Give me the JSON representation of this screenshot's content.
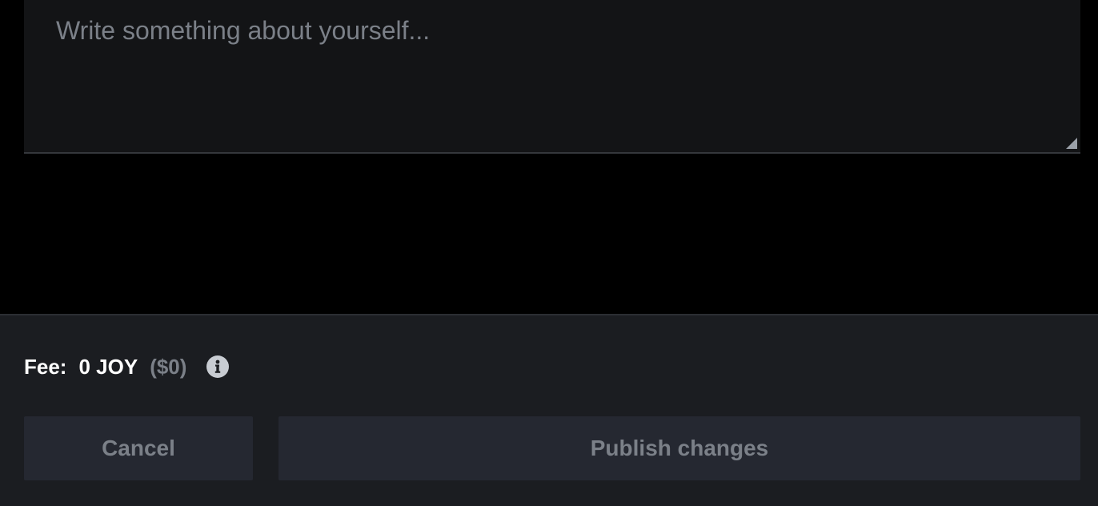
{
  "bio": {
    "placeholder": "Write something about yourself...",
    "value": ""
  },
  "fee": {
    "label": "Fee:",
    "amount": "0 JOY",
    "usd": "($0)",
    "info_icon": "info-icon"
  },
  "actions": {
    "cancel_label": "Cancel",
    "publish_label": "Publish changes"
  },
  "colors": {
    "background": "#000000",
    "textarea_bg": "#131416",
    "footer_bg": "#1b1d21",
    "button_bg": "#252831",
    "muted_text": "#7b8088",
    "primary_text": "#ffffff"
  }
}
